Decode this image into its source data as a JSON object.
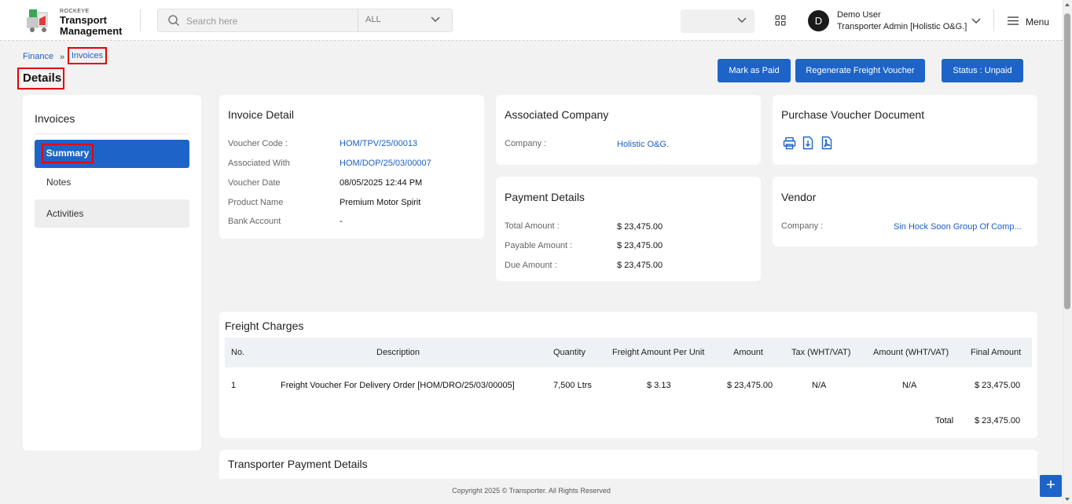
{
  "header": {
    "brand_small": "ROCKEYE",
    "brand_line1": "Transport",
    "brand_line2": "Management",
    "search_placeholder": "Search here",
    "search_scope": "ALL",
    "user_initial": "D",
    "user_name": "Demo User",
    "user_role": "Transporter Admin [Holistic O&G.]",
    "menu_label": "Menu"
  },
  "breadcrumb": {
    "parent": "Finance",
    "separator": "»",
    "current": "Invoices"
  },
  "page_title": "Details",
  "actions": {
    "mark_paid": "Mark as Paid",
    "regenerate": "Regenerate Freight Voucher",
    "status": "Status : Unpaid"
  },
  "sidebar": {
    "title": "Invoices",
    "items": [
      {
        "label": "Summary"
      },
      {
        "label": "Notes"
      },
      {
        "label": "Activities"
      }
    ]
  },
  "invoice_detail": {
    "title": "Invoice Detail",
    "rows": [
      {
        "label": "Voucher Code :",
        "value": "HOM/TPV/25/00013"
      },
      {
        "label": "Associated With",
        "value": "HOM/DOP/25/03/00007"
      },
      {
        "label": "Voucher Date",
        "value": "08/05/2025 12:44 PM"
      },
      {
        "label": "Product Name",
        "value": "Premium Motor Spirit"
      },
      {
        "label": "Bank Account",
        "value": "-"
      }
    ]
  },
  "associated_company": {
    "title": "Associated Company",
    "label": "Company :",
    "value": "Holistic O&G."
  },
  "payment_details": {
    "title": "Payment Details",
    "rows": [
      {
        "label": "Total Amount :",
        "value": "$ 23,475.00"
      },
      {
        "label": "Payable Amount :",
        "value": "$ 23,475.00"
      },
      {
        "label": "Due Amount :",
        "value": "$ 23,475.00"
      }
    ]
  },
  "purchase_voucher": {
    "title": "Purchase Voucher Document",
    "icons": [
      "print-icon",
      "download-icon",
      "pdf-icon"
    ]
  },
  "vendor": {
    "title": "Vendor",
    "label": "Company :",
    "value": "Sin Hock Soon Group Of Comp..."
  },
  "freight": {
    "title": "Freight Charges",
    "columns": [
      "No.",
      "Description",
      "Quantity",
      "Freight Amount Per Unit",
      "Amount",
      "Tax (WHT/VAT)",
      "Amount (WHT/VAT)",
      "Final Amount"
    ],
    "rows": [
      [
        "1",
        "Freight Voucher For Delivery Order [HOM/DRO/25/03/00005]",
        "7,500 Ltrs",
        "$ 3.13",
        "$ 23,475.00",
        "N/A",
        "N/A",
        "$ 23,475.00"
      ]
    ],
    "total_label": "Total",
    "total_value": "$ 23,475.00"
  },
  "transporter_payment": {
    "title": "Transporter Payment Details"
  },
  "footer": {
    "text": "Copyright 2025 © Transporter. All Rights Reserved"
  },
  "fab": {
    "label": "+"
  }
}
